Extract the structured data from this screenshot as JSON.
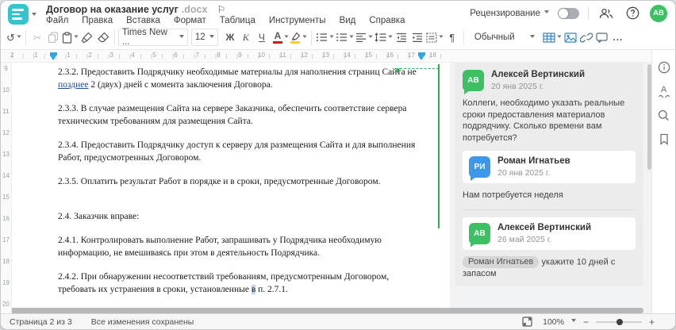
{
  "colors": {
    "accent_teal": "#35c3ce",
    "avatar_green": "#3cc062",
    "avatar_blue": "#3d97ea",
    "comment_green": "#2fae53",
    "ruler_marker_blue": "#2aa9e0",
    "inserted_text_blue": "#1f4e96",
    "selection_highlight": "#bdd6f2"
  },
  "header": {
    "title": "Договор на оказание услуг",
    "title_ext": ".docx",
    "flag_icon": "⚐",
    "menus": [
      "Файл",
      "Правка",
      "Вставка",
      "Формат",
      "Таблица",
      "Инструменты",
      "Вид",
      "Справка"
    ],
    "review_label": "Рецензирование",
    "avatar_initials": "АВ"
  },
  "toolbar": {
    "undo_glyph": "↻",
    "cut_glyph": "✂",
    "font_name": "Times New ...",
    "font_size": "12",
    "bold_label": "Ж",
    "italic_label": "К",
    "underline_label": "Ч",
    "font_color_label": "А",
    "pilcrow": "¶",
    "style_name": "Обычный",
    "more_label": "..."
  },
  "ruler": {
    "h_left_numbers": [
      "2",
      "1"
    ],
    "h_numbers": [
      "1",
      "2",
      "3",
      "4",
      "5",
      "6",
      "7",
      "8",
      "9",
      "10",
      "11",
      "12",
      "13",
      "14",
      "15",
      "16",
      "17",
      "18"
    ],
    "v_numbers": [
      "9",
      "10",
      "11",
      "12",
      "13",
      "14",
      "15",
      "16",
      "17",
      "18",
      "19",
      "20"
    ]
  },
  "document": {
    "p1": {
      "pre": "2.3.2. Предоставить Подрядчику необходимые материалы для наполнения страниц Сайта не ",
      "inserted": "позднее",
      "post": " 2 (двух) дней с момента заключения Договора."
    },
    "p2": "2.3.3. В случае размещения Сайта на сервере Заказчика, обеспечить соответствие сервера техническим требованиям для размещения Сайта.",
    "p3": "2.3.4. Предоставить Подрядчику доступ к серверу для размещения Сайта и для выполнения Работ, предусмотренных Договором.",
    "p4": "2.3.5. Оплатить результат Работ в порядке и в сроки, предусмотренные Договором.",
    "p5": "2.4. Заказчик вправе:",
    "p6": "2.4.1. Контролировать выполнение Работ, запрашивать у Подрядчика необходимую информацию, не вмешиваясь при этом в деятельность Подрядчика.",
    "p7": {
      "pre": "2.4.2. При обнаружении несоответствий требованиям, предусмотренным Договором, требовать их устранения в сроки, установленные ",
      "highlighted": "в",
      "post": " п. 2.7.1."
    }
  },
  "comments": {
    "thread": [
      {
        "author": "Алексей Вертинский",
        "initials": "АВ",
        "date": "20 янв 2025 г.",
        "text": "Коллеги, необходимо указать реальные сроки предоставления материалов подрядчику. Сколько времени вам потребуется?"
      },
      {
        "author": "Роман Игнатьев",
        "initials": "РИ",
        "date": "20 янв 2025 г.",
        "text": "Нам потребуется неделя"
      },
      {
        "author": "Алексей Вертинский",
        "initials": "АВ",
        "date": "26 май 2025 г.",
        "mention": "Роман Игнатьев",
        "text": " укажите 10 дней с запасом"
      }
    ]
  },
  "statusbar": {
    "page_info": "Страница 2 из 3",
    "save_status": "Все изменения сохранены",
    "zoom_level": "100%",
    "zoom_out": "−",
    "zoom_in": "+"
  }
}
